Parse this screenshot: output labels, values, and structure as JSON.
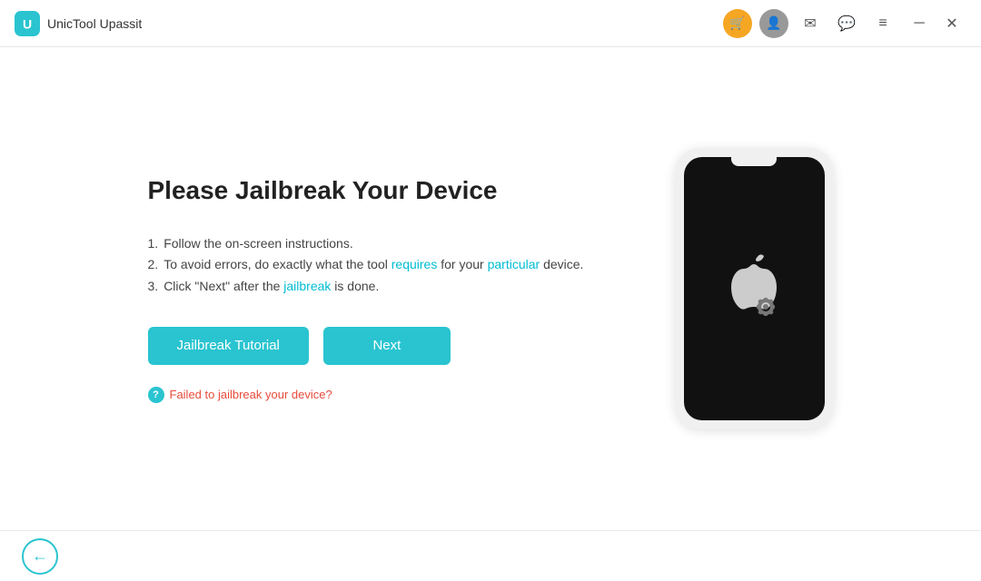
{
  "titlebar": {
    "app_name": "UnicTool Upassit",
    "cart_icon": "🛒",
    "user_icon": "👤",
    "mail_icon": "✉",
    "chat_icon": "💬",
    "menu_icon": "≡",
    "minimize_icon": "─",
    "close_icon": "✕"
  },
  "main": {
    "heading": "Please Jailbreak Your Device",
    "instructions": [
      {
        "num": "1.",
        "text": "Follow the on-screen instructions."
      },
      {
        "num": "2.",
        "text_before": "To avoid errors, do exactly what the tool ",
        "highlight": "requires",
        "text_middle": " for your ",
        "highlight2": "particular",
        "text_after": " device."
      },
      {
        "num": "3.",
        "text_before": "Click \"Next\" after the ",
        "highlight": "jailbreak",
        "text_after": " is done."
      }
    ],
    "btn_tutorial": "Jailbreak Tutorial",
    "btn_next": "Next",
    "fail_link": "Failed to jailbreak your device?"
  },
  "footer": {
    "back_icon": "←"
  }
}
